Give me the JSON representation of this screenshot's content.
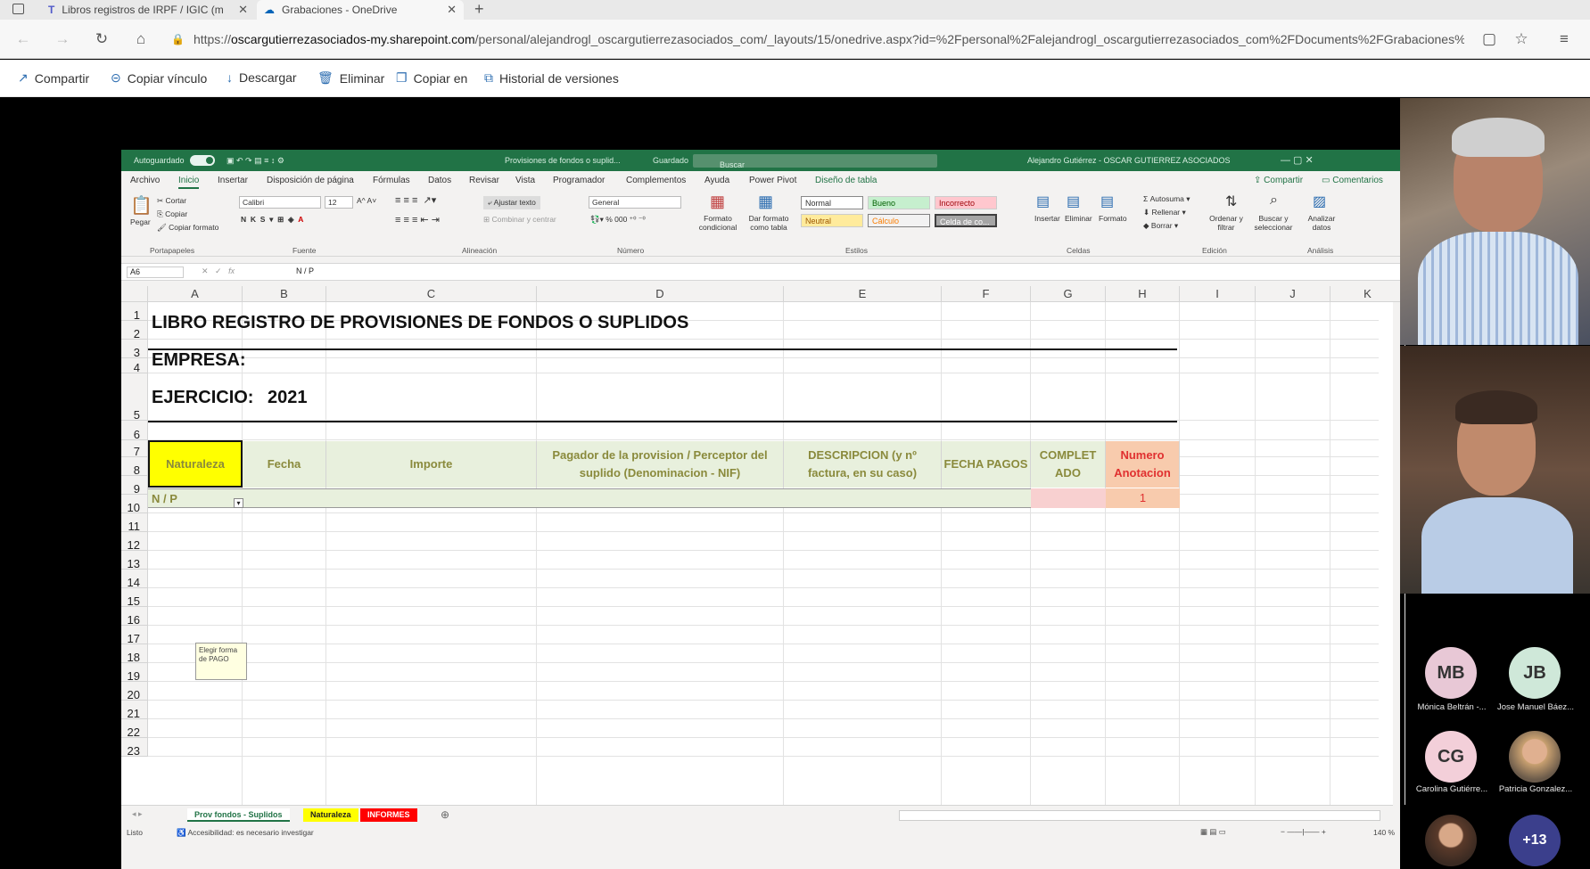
{
  "browser": {
    "tabs": [
      {
        "label": "Libros registros de IRPF / IGIC (m"
      },
      {
        "label": "Grabaciones - OneDrive"
      }
    ],
    "url_domain": "oscargutierrezasociados-my.sharepoint.com",
    "url_rest": "/personal/alejandrogl_oscargutierrezasociados_com/_layouts/15/onedrive.aspx?id=%2Fpersonal%2Falejandrogl_oscargutierrezasociados_com%2FDocuments%2FGrabaciones%...",
    "url_prefix": "https://"
  },
  "commandbar": {
    "share": "Compartir",
    "copy_link": "Copiar vínculo",
    "download": "Descargar",
    "delete": "Eliminar",
    "copy_to": "Copiar en",
    "history": "Historial de versiones"
  },
  "excel": {
    "autosave": "Autoguardado",
    "doc_title": "Provisiones de fondos o suplid...",
    "saved": "Guardado",
    "search": "Buscar",
    "user": "Alejandro Gutiérrez - OSCAR GUTIERREZ ASOCIADOS",
    "menus": [
      "Archivo",
      "Inicio",
      "Insertar",
      "Disposición de página",
      "Fórmulas",
      "Datos",
      "Revisar",
      "Vista",
      "Programador",
      "Complementos",
      "Ayuda",
      "Power Pivot",
      "Diseño de tabla"
    ],
    "share": "Compartir",
    "comments": "Comentarios",
    "ribbon": {
      "paste": "Pegar",
      "cut": "Cortar",
      "copy": "Copiar",
      "format_painter": "Copiar formato",
      "clipboard": "Portapapeles",
      "font_name": "Calibri",
      "font_size": "12",
      "font_group": "Fuente",
      "wrap": "Ajustar texto",
      "merge": "Combinar y centrar",
      "alignment": "Alineación",
      "number_format": "General",
      "number": "Número",
      "cond_format": "Formato condicional",
      "format_table": "Dar formato como tabla",
      "styles": "Estilos",
      "style_normal": "Normal",
      "style_bueno": "Bueno",
      "style_incorrecto": "Incorrecto",
      "style_neutral": "Neutral",
      "style_calculo": "Cálculo",
      "style_celda": "Celda de co...",
      "insert": "Insertar",
      "delete": "Eliminar",
      "format": "Formato",
      "cells": "Celdas",
      "autosum": "Autosuma",
      "fill": "Rellenar",
      "clear": "Borrar",
      "sort": "Ordenar y filtrar",
      "find": "Buscar y seleccionar",
      "editing": "Edición",
      "analyze": "Analizar datos",
      "analysis": "Análisis"
    },
    "name_box": "A6",
    "formula": "N / P",
    "columns": [
      "A",
      "B",
      "C",
      "D",
      "E",
      "F",
      "G",
      "H",
      "I",
      "J",
      "K"
    ],
    "rows": [
      "1",
      "2",
      "3",
      "4",
      "5",
      "6",
      "7",
      "8",
      "9",
      "10",
      "11",
      "12",
      "13",
      "14",
      "15",
      "16",
      "17",
      "18",
      "19",
      "20",
      "21",
      "22",
      "23"
    ],
    "sheet": {
      "title": "LIBRO REGISTRO DE PROVISIONES DE FONDOS O SUPLIDOS",
      "empresa": "EMPRESA:",
      "ejercicio": "EJERCICIO:",
      "year": "2021",
      "headers": {
        "a": "Naturaleza",
        "b": "Fecha",
        "c": "Importe",
        "d": "Pagador de la provision / Perceptor del suplido (Denominacion - NIF)",
        "e": "DESCRIPCION (y nº factura, en su caso)",
        "f": "FECHA PAGOS",
        "g": "COMPLETADO",
        "h": "Numero Anotacion"
      },
      "row6_a": "N / P",
      "row6_h": "1",
      "tooltip": "Elegir forma de PAGO"
    },
    "sheet_tabs": [
      "Prov fondos - Suplidos",
      "Naturaleza",
      "INFORMES"
    ],
    "status": "Listo",
    "accessibility": "Accesibilidad: es necesario investigar",
    "zoom": "140 %"
  },
  "participants": [
    {
      "initials": "MB",
      "name": "Mónica Beltrán -...",
      "color": "#e8c8d6"
    },
    {
      "initials": "JB",
      "name": "Jose Manuel Báez...",
      "color": "#cfe8d9"
    },
    {
      "initials": "CG",
      "name": "Carolina Gutiérre...",
      "color": "#f3cfd9"
    },
    {
      "initials": "",
      "name": "Patricia Gonzalez..."
    },
    {
      "initials": "+13",
      "name": "",
      "color": "#3b3f8c"
    }
  ]
}
